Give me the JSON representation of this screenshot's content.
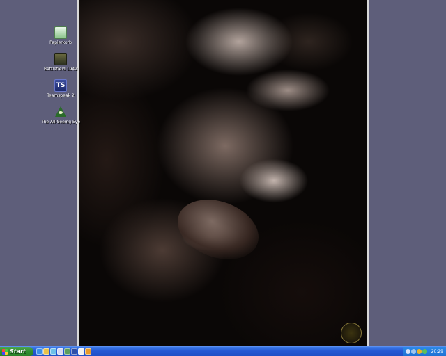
{
  "desktop": {
    "icons": [
      {
        "label": "Papierkorb",
        "icon": "recycle-bin-icon"
      },
      {
        "label": "Battlefield 1942",
        "icon": "battlefield-icon"
      },
      {
        "label": "Teamspeak 2",
        "icon": "teamspeak-icon",
        "glyph": "TS"
      },
      {
        "label": "The All-Seeing Eye",
        "icon": "all-seeing-eye-icon"
      }
    ],
    "wallpaper": "black-and-white portrait photo"
  },
  "taskbar": {
    "start_label": "Start",
    "quicklaunch": [
      "ie-icon",
      "folder-icon",
      "media-icon",
      "mail-icon",
      "app-icon",
      "network-icon",
      "settings-icon",
      "security-icon"
    ],
    "tray": [
      "volume-icon",
      "network-status-icon",
      "antivirus-icon",
      "messenger-icon"
    ],
    "clock": "20:29"
  },
  "colors": {
    "desktop_bg": "#5e5e7a",
    "taskbar": "#2458d3",
    "start_button": "#2f8c2f"
  }
}
